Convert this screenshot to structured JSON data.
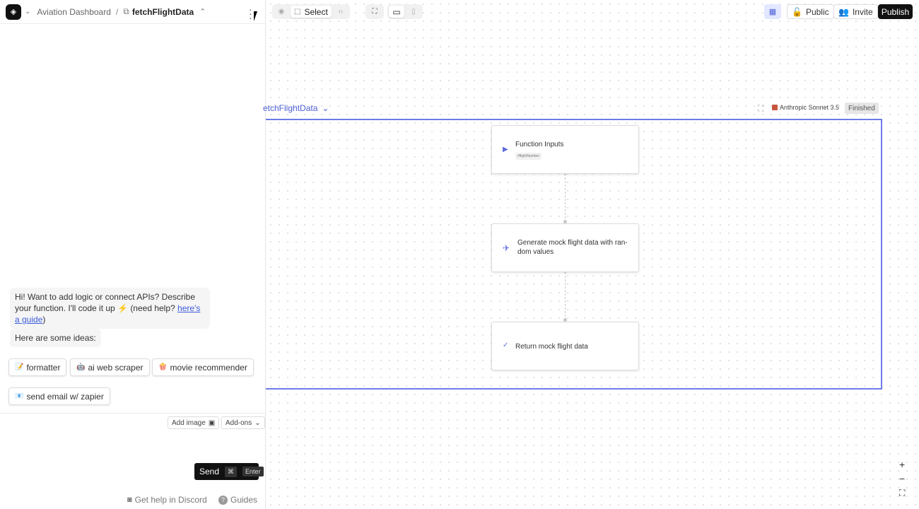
{
  "header": {
    "project": "Aviation Dashboard",
    "separator": "/",
    "function_name": "fetchFlightData"
  },
  "chat": {
    "greeting_text": "Hi! Want to add logic or connect APIs? Describe your function. I'll code it up ⚡ (need help? ",
    "guide_link": "here's a guide",
    "greeting_end": ")",
    "ideas_heading": "Here are some ideas:",
    "ideas": [
      {
        "emoji": "📝",
        "label": "formatter"
      },
      {
        "emoji": "🤖",
        "label": "ai web scraper"
      },
      {
        "emoji": "🍿",
        "label": "movie recommender"
      },
      {
        "emoji": "📧",
        "label": "send email w/ zapier"
      }
    ],
    "add_image": "Add image",
    "addons": "Add-ons",
    "send": "Send",
    "send_kbd_cmd": "⌘",
    "send_kbd_enter": "Enter"
  },
  "footer": {
    "discord": "Get help in Discord",
    "guides": "Guides"
  },
  "toolbar": {
    "select": "Select",
    "public": "Public",
    "invite": "Invite",
    "publish": "Publish"
  },
  "flow": {
    "title": "etchFlightData",
    "model": "Anthropic Sonnet 3.5",
    "status": "Finished",
    "nodes": [
      {
        "label": "Function Inputs",
        "pill": "#flightNumber"
      },
      {
        "label": "Generate mock flight data with ran-\ndom values"
      },
      {
        "label": "Return mock flight data"
      }
    ]
  },
  "zoom": {
    "in": "+",
    "out": "−",
    "fit": "⛶"
  },
  "colors": {
    "accent": "#5d6be0",
    "frame": "#6d7be8",
    "dark": "#111111"
  }
}
